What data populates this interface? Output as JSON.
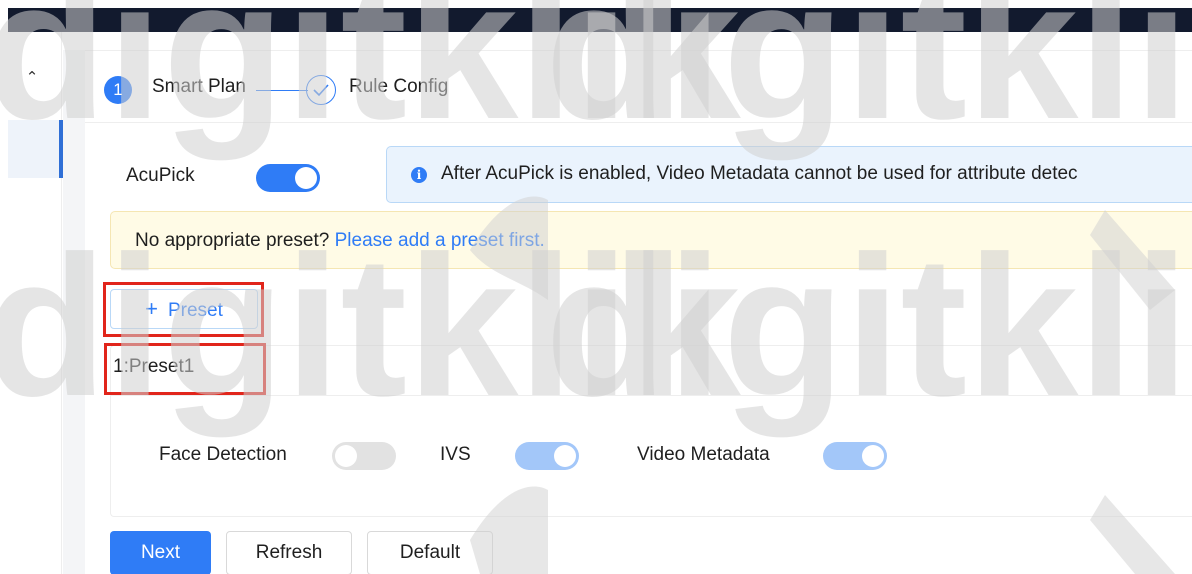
{
  "steps": [
    {
      "number": "1",
      "label": "Smart Plan"
    },
    {
      "label": "Rule Config"
    }
  ],
  "acupick": {
    "label": "AcuPick",
    "enabled": true,
    "notice": "After AcuPick is enabled, Video Metadata cannot be used for attribute detec"
  },
  "preset_notice": {
    "text": "No appropriate preset?",
    "link": "Please add a preset first."
  },
  "add_preset_button": {
    "icon": "plus-icon",
    "label": "Preset"
  },
  "preset": {
    "name": "1:Preset1",
    "options": [
      {
        "label": "Face Detection",
        "state": "off"
      },
      {
        "label": "IVS",
        "state": "on-disabled"
      },
      {
        "label": "Video Metadata",
        "state": "on-disabled"
      }
    ]
  },
  "buttons": {
    "next": "Next",
    "refresh": "Refresh",
    "default": "Default"
  },
  "watermark": "digitklik",
  "colors": {
    "primary": "#2f7cf6",
    "highlight": "#e1251b",
    "topbar": "#121a2e"
  }
}
